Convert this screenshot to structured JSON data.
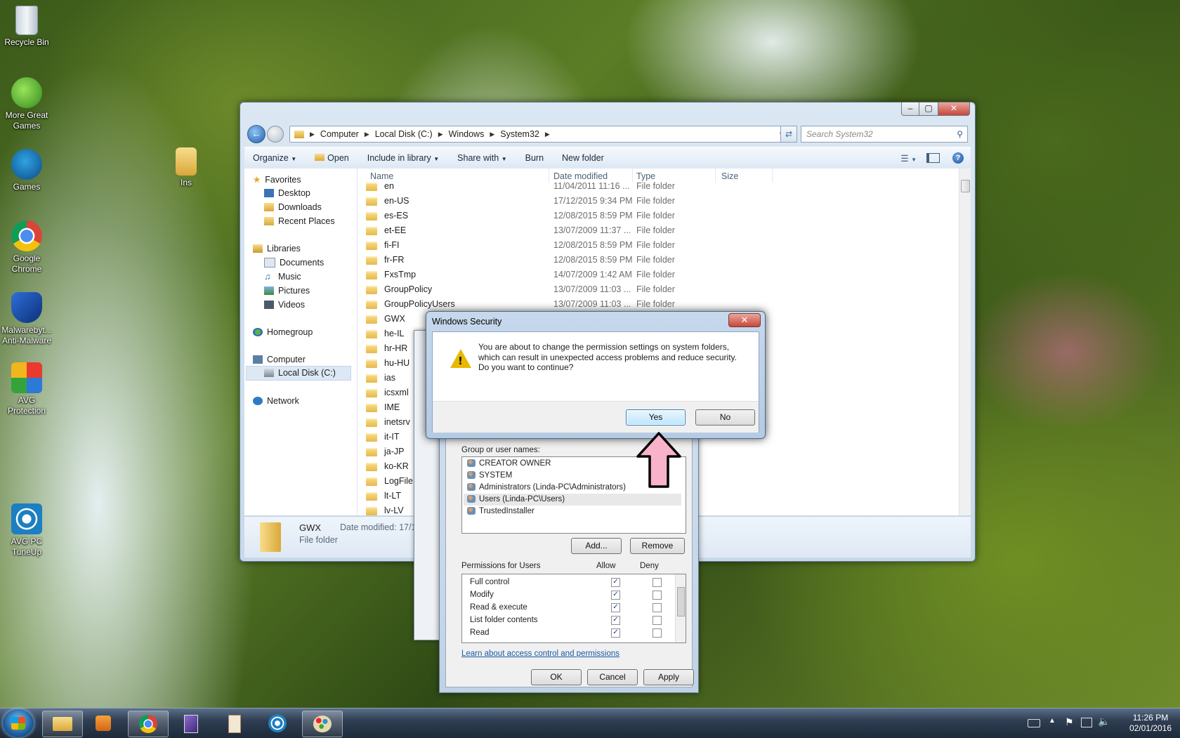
{
  "desktop_icons": [
    {
      "label": "Recycle Bin",
      "icon": "recycle-bin-icon"
    },
    {
      "label": "More Great Games",
      "icon": "games-icon"
    },
    {
      "label": "Games",
      "icon": "big-fish-icon"
    },
    {
      "label": "Google Chrome",
      "icon": "chrome-icon"
    },
    {
      "label": "Malwarebyt... Anti-Malware",
      "icon": "malwarebytes-icon"
    },
    {
      "label": "AVG Protection",
      "icon": "avg-icon"
    },
    {
      "label": "AVG PC TuneUp",
      "icon": "avg-tuneup-icon"
    },
    {
      "label": "Ins",
      "icon": "folder-icon"
    }
  ],
  "explorer": {
    "breadcrumb": [
      "Computer",
      "Local Disk (C:)",
      "Windows",
      "System32"
    ],
    "search_placeholder": "Search System32",
    "toolbar": [
      "Organize",
      "Open",
      "Include in library",
      "Share with",
      "Burn",
      "New folder"
    ],
    "nav": {
      "favorites": "Favorites",
      "desktop": "Desktop",
      "downloads": "Downloads",
      "recent": "Recent Places",
      "libraries": "Libraries",
      "documents": "Documents",
      "music": "Music",
      "pictures": "Pictures",
      "videos": "Videos",
      "homegroup": "Homegroup",
      "computer": "Computer",
      "localdisk": "Local Disk (C:)",
      "network": "Network"
    },
    "columns": {
      "name": "Name",
      "date": "Date modified",
      "type": "Type",
      "size": "Size"
    },
    "rows": [
      {
        "name": "en",
        "date": "11/04/2011 11:16 ...",
        "type": "File folder"
      },
      {
        "name": "en-US",
        "date": "17/12/2015 9:34 PM",
        "type": "File folder"
      },
      {
        "name": "es-ES",
        "date": "12/08/2015 8:59 PM",
        "type": "File folder"
      },
      {
        "name": "et-EE",
        "date": "13/07/2009 11:37 ...",
        "type": "File folder"
      },
      {
        "name": "fi-FI",
        "date": "12/08/2015 8:59 PM",
        "type": "File folder"
      },
      {
        "name": "fr-FR",
        "date": "12/08/2015 8:59 PM",
        "type": "File folder"
      },
      {
        "name": "FxsTmp",
        "date": "14/07/2009 1:42 AM",
        "type": "File folder"
      },
      {
        "name": "GroupPolicy",
        "date": "13/07/2009 11:03 ...",
        "type": "File folder"
      },
      {
        "name": "GroupPolicyUsers",
        "date": "13/07/2009 11:03 ...",
        "type": "File folder"
      },
      {
        "name": "GWX",
        "date": "",
        "type": ""
      },
      {
        "name": "he-IL",
        "date": "",
        "type": ""
      },
      {
        "name": "hr-HR",
        "date": "",
        "type": ""
      },
      {
        "name": "hu-HU",
        "date": "",
        "type": ""
      },
      {
        "name": "ias",
        "date": "",
        "type": ""
      },
      {
        "name": "icsxml",
        "date": "",
        "type": ""
      },
      {
        "name": "IME",
        "date": "",
        "type": ""
      },
      {
        "name": "inetsrv",
        "date": "",
        "type": ""
      },
      {
        "name": "it-IT",
        "date": "",
        "type": ""
      },
      {
        "name": "ja-JP",
        "date": "",
        "type": ""
      },
      {
        "name": "ko-KR",
        "date": "",
        "type": ""
      },
      {
        "name": "LogFile",
        "date": "",
        "type": ""
      },
      {
        "name": "lt-LT",
        "date": "",
        "type": ""
      },
      {
        "name": "lv-LV",
        "date": "",
        "type": ""
      }
    ],
    "details": {
      "name": "GWX",
      "type": "File folder",
      "date": "Date modified: 17/1"
    }
  },
  "permissions": {
    "group_label": "Group or user names:",
    "users": [
      "CREATOR OWNER",
      "SYSTEM",
      "Administrators (Linda-PC\\Administrators)",
      "Users (Linda-PC\\Users)",
      "TrustedInstaller"
    ],
    "add": "Add...",
    "remove": "Remove",
    "perm_label": "Permissions for Users",
    "allow": "Allow",
    "deny": "Deny",
    "perms": [
      "Full control",
      "Modify",
      "Read & execute",
      "List folder contents",
      "Read"
    ],
    "link": "Learn about access control and permissions",
    "ok": "OK",
    "cancel": "Cancel",
    "apply": "Apply"
  },
  "security_dialog": {
    "title": "Windows Security",
    "line1": "You are about to change the permission settings on system folders,",
    "line2": "which can result in unexpected access problems and reduce security.",
    "line3": "Do you want to continue?",
    "yes": "Yes",
    "no": "No"
  },
  "taskbar": {
    "time": "11:26 PM",
    "date": "02/01/2016"
  }
}
